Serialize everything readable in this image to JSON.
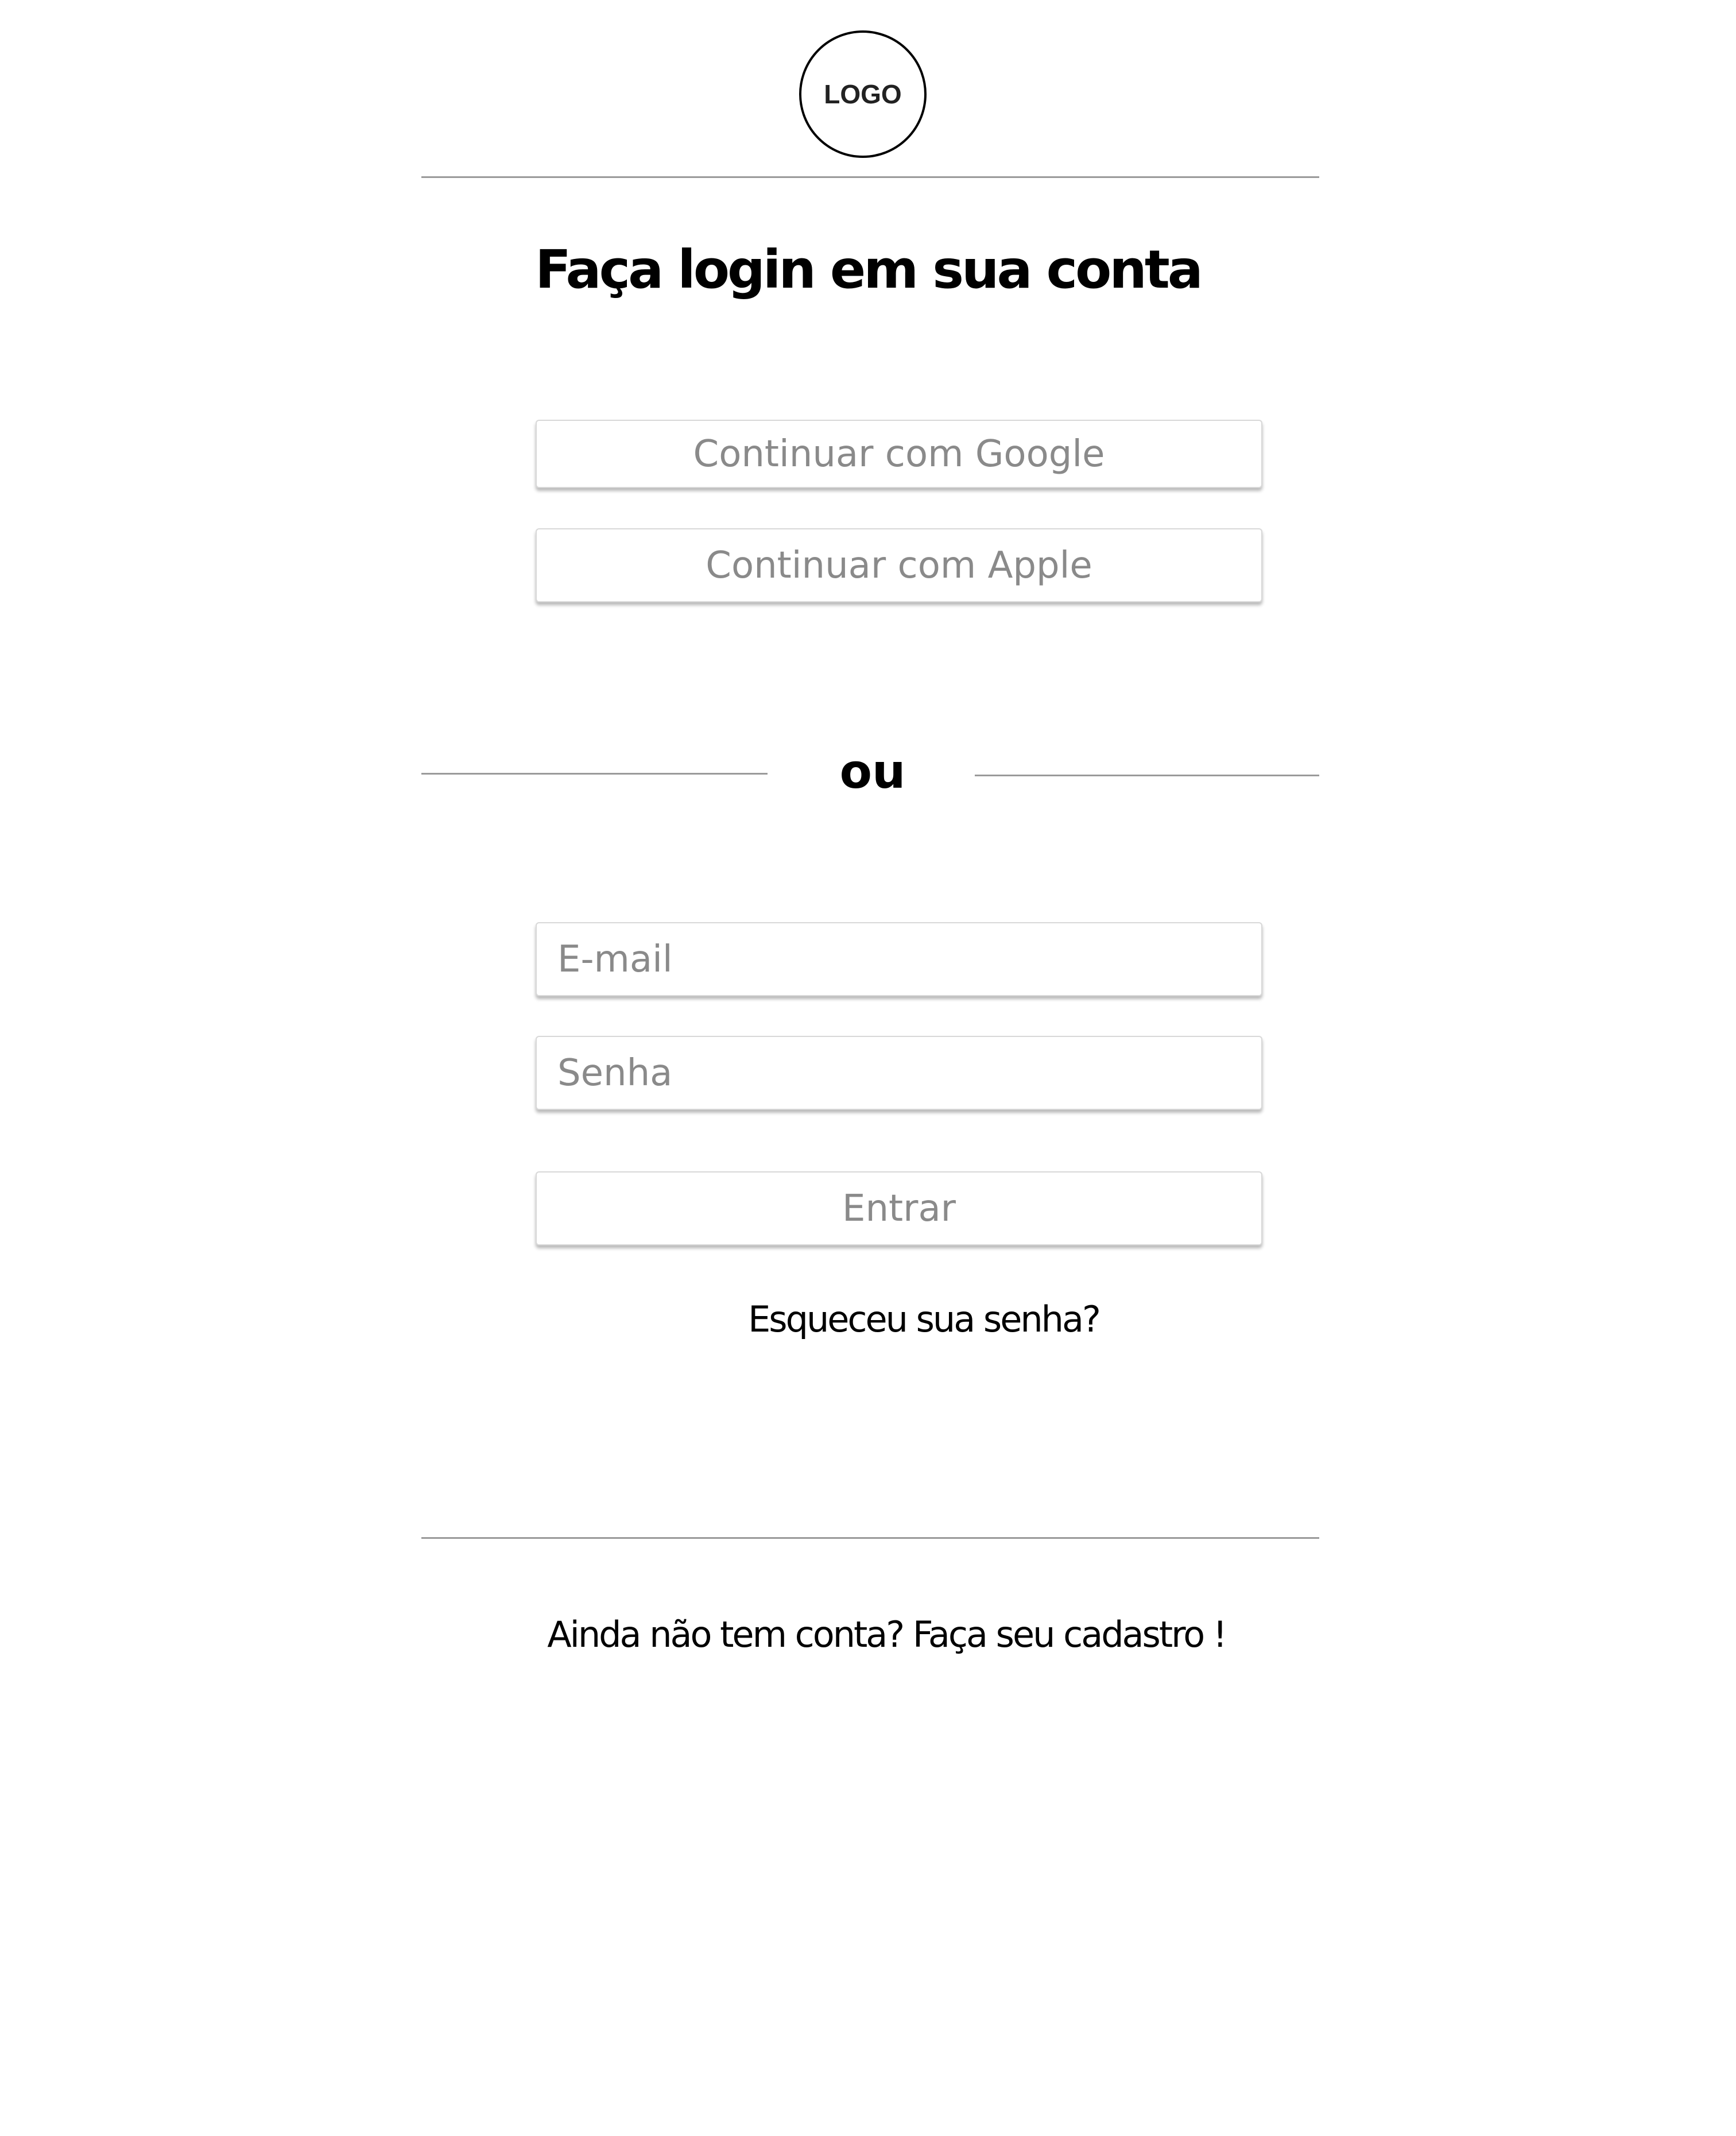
{
  "logo": {
    "text": "LOGO"
  },
  "header": {
    "title": "Faça login em sua conta"
  },
  "social": {
    "google_label": "Continuar com Google",
    "apple_label": "Continuar com Apple"
  },
  "divider": {
    "or_label": "ou"
  },
  "form": {
    "email_placeholder": "E-mail",
    "password_placeholder": "Senha",
    "submit_label": "Entrar",
    "forgot_password_label": "Esqueceu sua senha?"
  },
  "footer": {
    "signup_label": "Ainda não tem conta? Faça seu cadastro !"
  }
}
